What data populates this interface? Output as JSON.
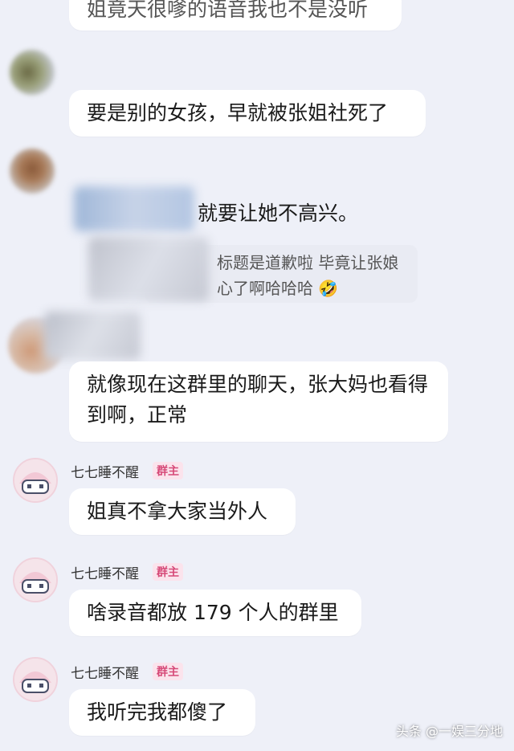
{
  "messages": {
    "m0": "姐竟天很嗲的语音我也不是没听",
    "m1": "要是别的女孩，早就被张姐社死了",
    "m2": "就要让她不高兴。",
    "m2_quote_line1": "标题是道歉啦 毕竟让张娘",
    "m2_quote_line2": "心了啊哈哈哈",
    "m2_quote_emoji": "🤣",
    "m3": "就像现在这群里的聊天，张大妈也看得到啊，正常",
    "m4": "姐真不拿大家当外人",
    "m5": "啥录音都放 179 个人的群里",
    "m6": "我听完我都傻了"
  },
  "sender": {
    "name": "七七睡不醒",
    "badge": "群主"
  },
  "watermark": "头条 @一娱三分地"
}
